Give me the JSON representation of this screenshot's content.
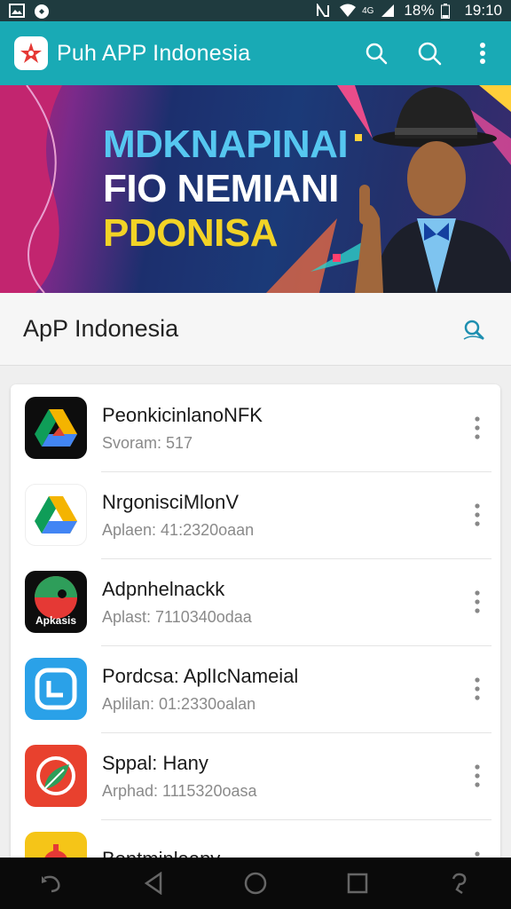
{
  "status_bar": {
    "left_icons": [
      "image-icon",
      "notification-icon"
    ],
    "battery": "18%",
    "time": "19:10",
    "signal_label": "4G"
  },
  "app_bar": {
    "title": "Puh APP Indonesia",
    "actions": [
      "search-icon",
      "search-icon"
    ],
    "colors": {
      "background": "#19aab5"
    }
  },
  "banner": {
    "line1": "MDKNAPINAI",
    "line2": "FIO NEMIANI",
    "line3": "PDONISA"
  },
  "section": {
    "title": "ApP Indonesia"
  },
  "apps": [
    {
      "name": "PeonkicinlanoNFK",
      "subtitle": "Svoram: 517",
      "icon": "drive-triangle-dark-icon"
    },
    {
      "name": "NrgonisciMlonV",
      "subtitle": "Aplaen: 41:2320oaan",
      "icon": "drive-triangle-light-icon"
    },
    {
      "name": "Adpnhelnackk",
      "subtitle": "Aplast: 7110340odaa",
      "icon": "apkasis-logo-icon"
    },
    {
      "name": "Pordcsa: AplIcNameial",
      "subtitle": "Aplilan: 01:2330oalan",
      "icon": "screen-app-icon"
    },
    {
      "name": "Sppal: Hany",
      "subtitle": "Arphad: 1115320oasa",
      "icon": "leaf-app-icon"
    },
    {
      "name": "Bontminlaapy",
      "subtitle": "",
      "icon": "gear-app-icon"
    }
  ]
}
